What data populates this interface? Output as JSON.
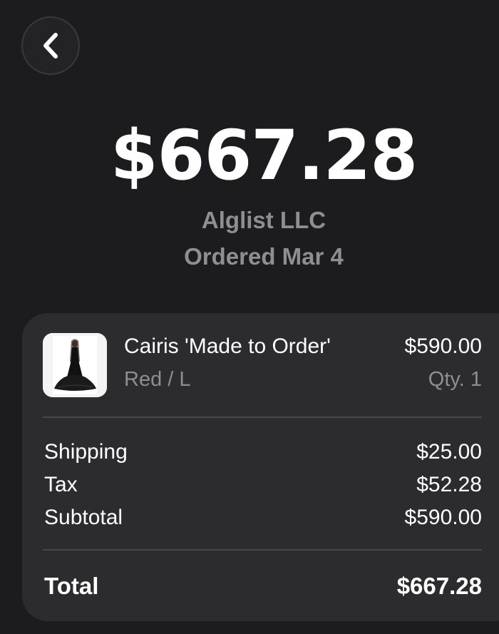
{
  "nav": {
    "back_icon": "chevron-left-icon"
  },
  "order": {
    "amount": "$667.28",
    "merchant": "Alglist LLC",
    "date": "Ordered Mar 4"
  },
  "item": {
    "image_icon": "dress-product-image",
    "name": "Cairis 'Made to Order'",
    "variant": "Red / L",
    "price": "$590.00",
    "quantity": "Qty. 1"
  },
  "summary": {
    "rows": [
      {
        "label": "Shipping",
        "value": "$25.00"
      },
      {
        "label": "Tax",
        "value": "$52.28"
      },
      {
        "label": "Subtotal",
        "value": "$590.00"
      }
    ],
    "total_label": "Total",
    "total_value": "$667.28"
  },
  "colors": {
    "background": "#1c1c1e",
    "card": "#2c2c2e",
    "secondary_text": "#8e8e93"
  }
}
